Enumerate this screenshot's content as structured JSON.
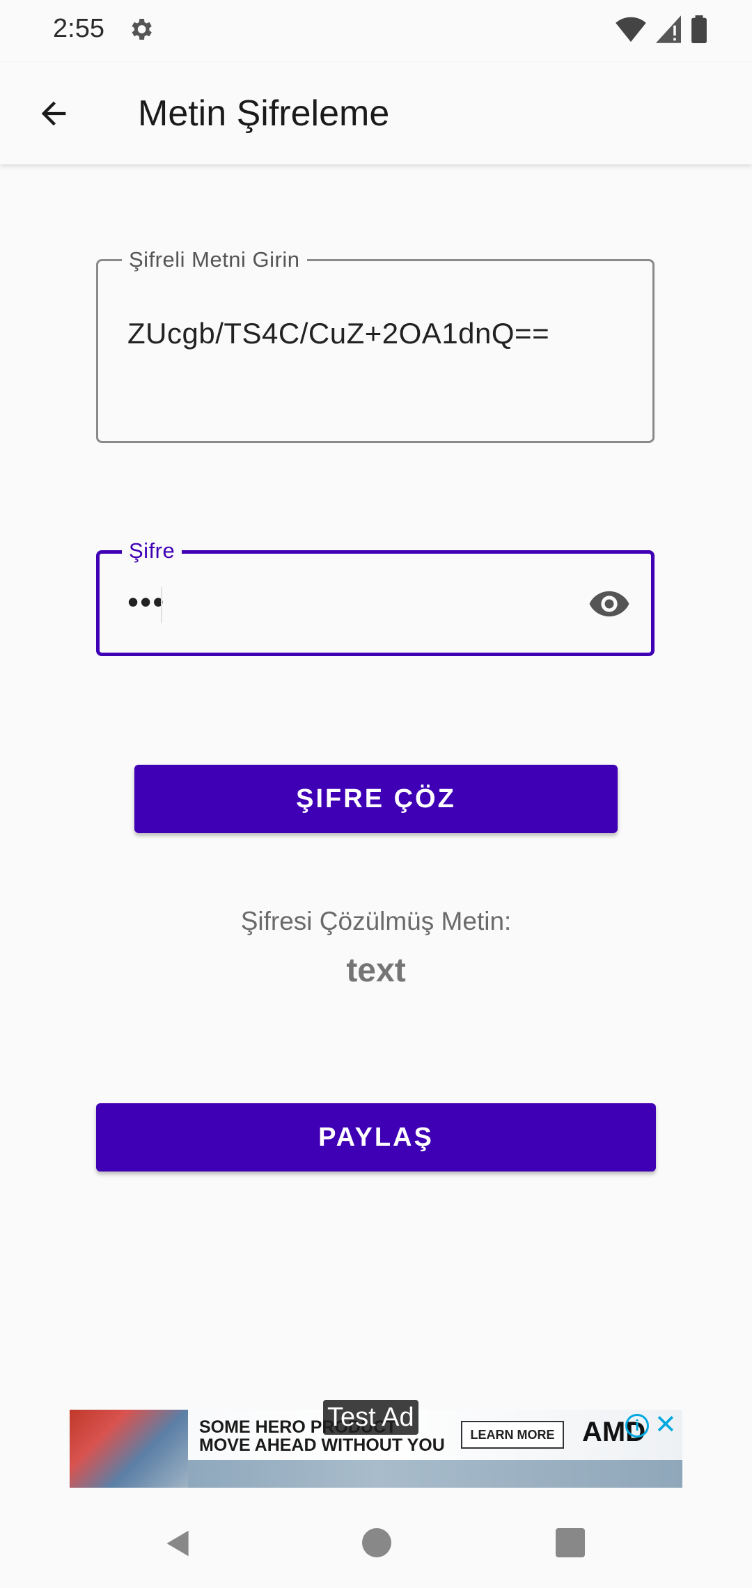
{
  "status_bar": {
    "time": "2:55"
  },
  "app_bar": {
    "title": "Metin Şifreleme"
  },
  "cipher_field": {
    "label": "Şifreli Metni Girin",
    "value": "ZUcgb/TS4C/CuZ+2OA1dnQ=="
  },
  "password_field": {
    "label": "Şifre",
    "value": "•••"
  },
  "decrypt_button": {
    "label": "ŞIFRE ÇÖZ"
  },
  "result": {
    "label": "Şifresi Çözülmüş Metin:",
    "text": "text"
  },
  "share_button": {
    "label": "PAYLAŞ"
  },
  "ad": {
    "test_label": "Test Ad",
    "headline_line1": "SOME HERO PRODUCT",
    "headline_line2": "MOVE AHEAD WITHOUT YOU",
    "cta": "LEARN MORE",
    "brand": "AMD"
  },
  "colors": {
    "primary": "#3f00b5",
    "background": "#fafafa"
  }
}
